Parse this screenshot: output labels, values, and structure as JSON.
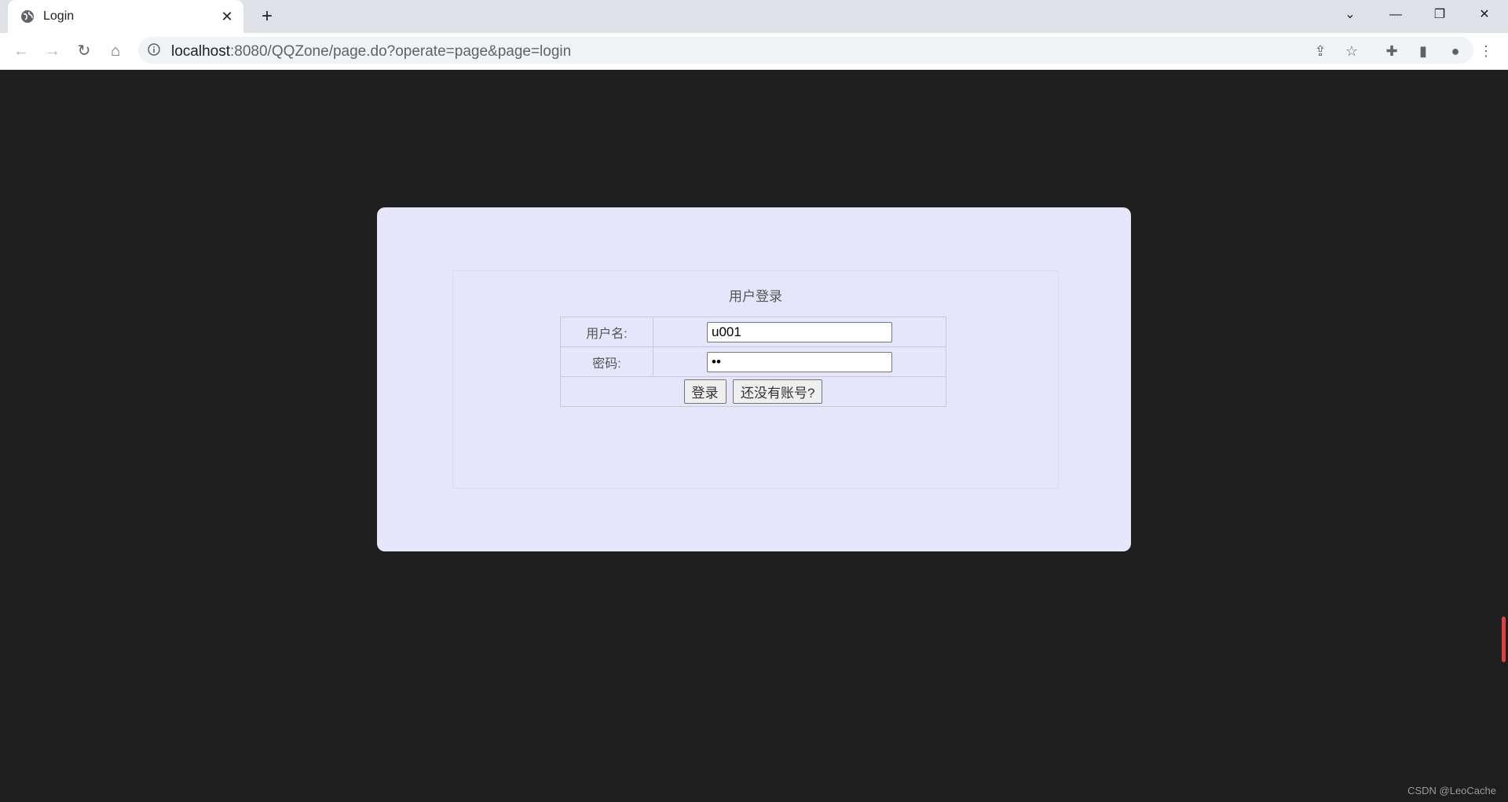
{
  "browser": {
    "tab_title": "Login",
    "url_host": "localhost",
    "url_rest": ":8080/QQZone/page.do?operate=page&page=login"
  },
  "login": {
    "title": "用户登录",
    "username_label": "用户名:",
    "username_value": "u001",
    "password_label": "密码:",
    "password_value": "••",
    "login_button": "登录",
    "register_button": "还没有账号?"
  },
  "colors": {
    "page_bg": "#1e1e1e",
    "panel_bg": "#e6e6fa"
  },
  "watermark": "CSDN @LeoCache"
}
